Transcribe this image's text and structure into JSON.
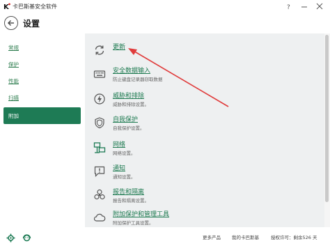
{
  "window": {
    "title": "卡巴斯基安全软件",
    "controls": [
      "?",
      "—",
      "✕"
    ]
  },
  "header": {
    "title": "设置"
  },
  "sidebar": {
    "items": [
      {
        "label": "常规"
      },
      {
        "label": "保护"
      },
      {
        "label": "性能"
      },
      {
        "label": "扫描"
      },
      {
        "label": "附加",
        "active": true
      }
    ]
  },
  "main": {
    "rows": [
      {
        "title": "更新",
        "desc": "",
        "icon": "refresh-icon"
      },
      {
        "title": "安全数据输入",
        "desc": "防止键盘记录器窃取数据",
        "icon": "keyboard-icon"
      },
      {
        "title": "威胁和排除",
        "desc": "威胁和排除设置。",
        "icon": "lightning-icon"
      },
      {
        "title": "自我保护",
        "desc": "自我保护设置。",
        "icon": "shield-icon"
      },
      {
        "title": "网络",
        "desc": "网络设置。",
        "icon": "network-icon"
      },
      {
        "title": "通知",
        "desc": "通知设置。",
        "icon": "speech-bubble-icon"
      },
      {
        "title": "报告和隔离",
        "desc": "报告和隔离设置。",
        "icon": "biohazard-icon"
      },
      {
        "title": "附加保护和管理工具",
        "desc": "附加保护工具设置。",
        "icon": "cloud-icon"
      }
    ]
  },
  "footer": {
    "more_products": "更多产品",
    "my_kaspersky": "我的卡巴斯基",
    "license": "授权许可：剩余526 天"
  },
  "colors": {
    "accent": "#1e7b55",
    "link": "#1d7a50",
    "panel_bg": "#eef0f1",
    "arrow": "#e03c3c"
  }
}
